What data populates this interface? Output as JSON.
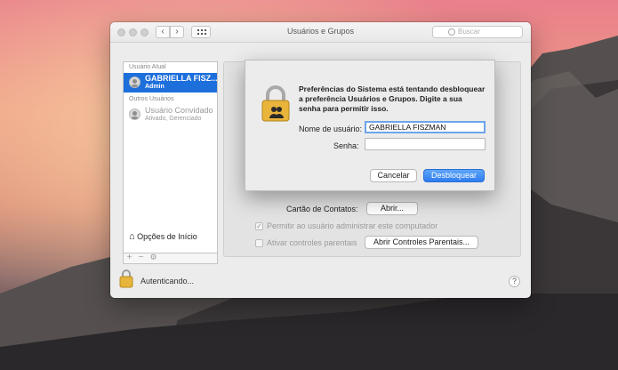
{
  "window": {
    "title": "Usuários e Grupos",
    "nav_back": "‹",
    "nav_forward": "›",
    "search_placeholder": "Buscar"
  },
  "sidebar": {
    "current_user_header": "Usuário Atual",
    "current_user": {
      "name": "GABRIELLA FISZ...",
      "role": "Admin"
    },
    "other_users_header": "Outros Usuários",
    "guest_user": {
      "name": "Usuário Convidado",
      "status": "Ativado, Gerenciado"
    },
    "login_options_label": "Opções de Início",
    "add_symbol": "+",
    "remove_symbol": "−",
    "gear_symbol": "⚙"
  },
  "main": {
    "contacts_card_label": "Cartão de Contatos:",
    "open_button_label": "Abrir...",
    "allow_admin_label": "Permitir ao usuário administrar este computador",
    "allow_admin_checked": true,
    "parental_controls_label": "Ativar controles parentais",
    "parental_controls_checked": false,
    "open_parental_controls_label": "Abrir Controles Parentais..."
  },
  "footer": {
    "status_text": "Autenticando...",
    "help_label": "?"
  },
  "dialog": {
    "message": "Preferências do Sistema está tentando desbloquear a preferência Usuários e Grupos. Digite a sua senha para permitir isso.",
    "username_label": "Nome de usuário:",
    "username_value": "GABRIELLA FISZMAN",
    "password_label": "Senha:",
    "password_value": "",
    "cancel_label": "Cancelar",
    "unlock_label": "Desbloquear"
  },
  "colors": {
    "selection": "#1d6fdc",
    "primary_button": "#2e7cf0"
  }
}
